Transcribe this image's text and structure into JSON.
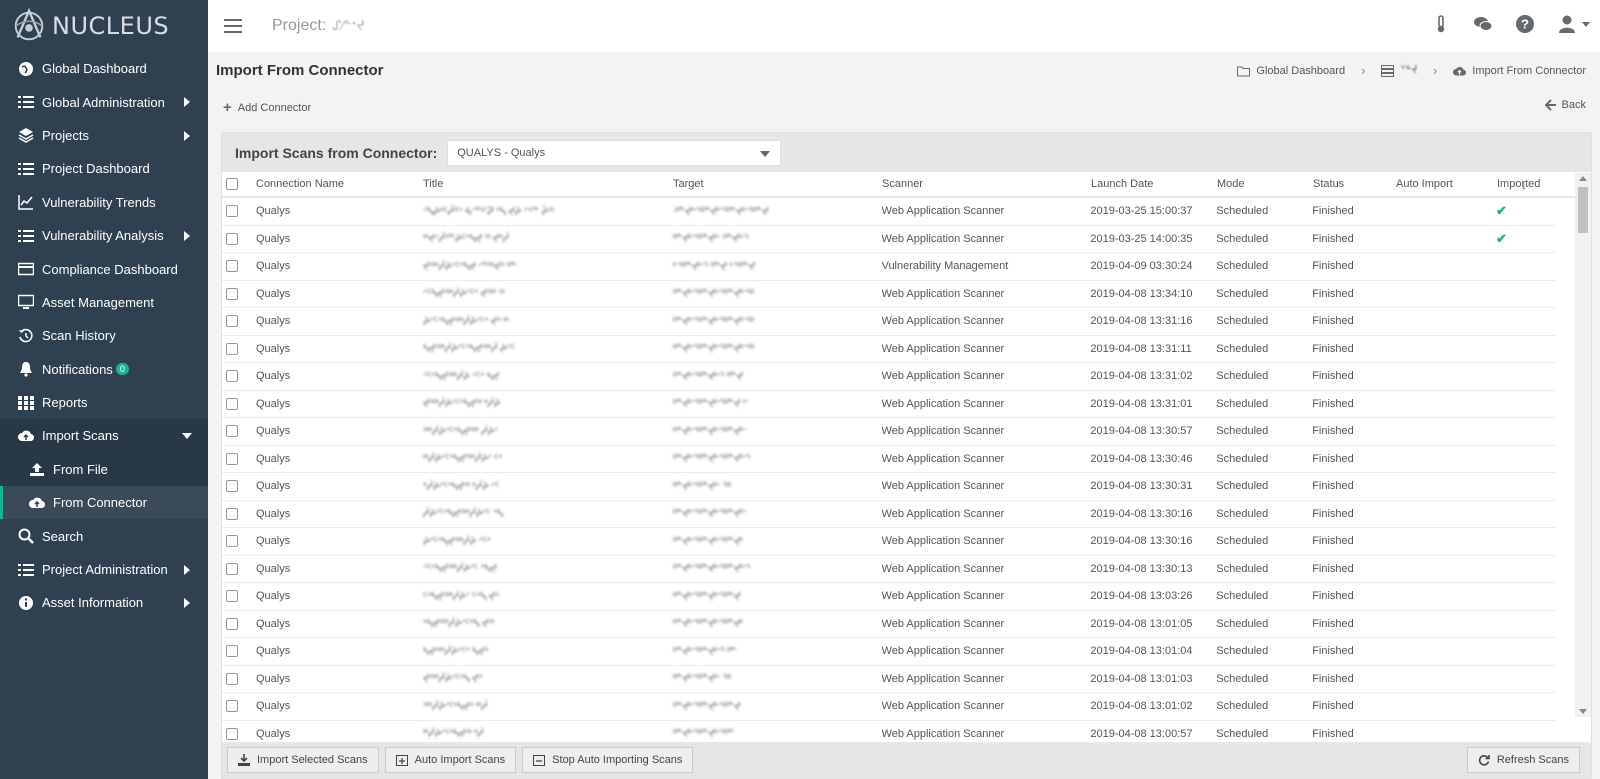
{
  "app": {
    "logo_text": "NUCLEUS"
  },
  "sidebar": {
    "items": [
      {
        "label": "Global Dashboard",
        "icon": "globe-icon"
      },
      {
        "label": "Global Administration",
        "icon": "list-icon"
      },
      {
        "label": "Projects",
        "icon": "layers-icon"
      },
      {
        "label": "Project Dashboard",
        "icon": "list-icon"
      },
      {
        "label": "Vulnerability Trends",
        "icon": "line-chart-icon"
      },
      {
        "label": "Vulnerability Analysis",
        "icon": "list-icon"
      },
      {
        "label": "Compliance Dashboard",
        "icon": "credit-card-icon"
      },
      {
        "label": "Asset Management",
        "icon": "desktop-icon"
      },
      {
        "label": "Scan History",
        "icon": "history-icon"
      },
      {
        "label": "Notifications",
        "icon": "bell-icon",
        "badge": "0"
      },
      {
        "label": "Reports",
        "icon": "grid-icon"
      },
      {
        "label": "Import Scans",
        "icon": "cloud-upload-icon"
      },
      {
        "label": "From File",
        "icon": "upload-icon"
      },
      {
        "label": "From Connector",
        "icon": "cloud-upload-icon"
      },
      {
        "label": "Search",
        "icon": "search-icon"
      },
      {
        "label": "Project Administration",
        "icon": "list-icon"
      },
      {
        "label": "Asset Information",
        "icon": "info-icon"
      }
    ]
  },
  "topbar": {
    "project_label": "Project:",
    "project_name": "ᔑ⁄ᓐᐩᔪ"
  },
  "page": {
    "title": "Import From Connector",
    "breadcrumb": [
      {
        "label": "Global Dashboard",
        "icon": "folder-icon"
      },
      {
        "label": "ᘁᓐᔪ",
        "icon": "server-icon"
      },
      {
        "label": "Import From Connector",
        "icon": "cloud-upload-icon"
      }
    ],
    "add_connector": "Add Connector",
    "back": "Back"
  },
  "panel": {
    "heading": "Import Scans from Connector:",
    "selected_connector": "QUALYS - Qualys",
    "columns": [
      "Connection Name",
      "Title",
      "Target",
      "Scanner",
      "Launch Date",
      "Mode",
      "Status",
      "Auto Import",
      "Imported"
    ],
    "rows": [
      {
        "name": "Qualys",
        "title": "ᐟᓴᔨᐤᑦᓲᕁᐩ ᔦᐨᓐᑊᐟᕈ ᐣᓴ ᔪᔨ ᐟᑉᓐ ᔩᐣᑊ",
        "target": "ᐧᐦᓐᔪᑊᐨᕐᐦᓐᔪᑊᐨᕐᐦᓐᔪᑊᐨᕐᐦᓐᔪ",
        "scanner": "Web Application Scanner",
        "date": "2019-03-25 15:00:37",
        "mode": "Scheduled",
        "status": "Finished",
        "imported": "✔"
      },
      {
        "name": "Qualys",
        "title": "ᑊᐤᔪᐟᓲᐣᓐᔨᑦᐩᓴᔪ ᐣᑊ ᔪᐤᓲ",
        "target": "ᐦᓐᔪᑊᐨᕐᐦᓐᔪᑊᐨ ᐦᓐᔪᑊᐨᕐ",
        "scanner": "Web Application Scanner",
        "date": "2019-03-25 14:00:35",
        "mode": "Scheduled",
        "status": "Finished",
        "imported": "✔"
      },
      {
        "name": "Qualys",
        "title": "ᔪᐣᑊᐤᓲᔨᐟᑦᐩᓴᔪ ᐟᓐᑊᐤᔪᐣ ᐦᓐ",
        "target": "ᑊᐨᕐᐦᓐᔪᑊᐨᕐ ᐦᓐᔪ ᑊᐨᕐᐦᓐᔪ",
        "scanner": "Vulnerability Management",
        "date": "2019-04-09 03:30:24",
        "mode": "Scheduled",
        "status": "Finished",
        "imported": ""
      },
      {
        "name": "Qualys",
        "title": "ᐟᑦᓴᔪᐣᑊᐤᓲᔨᐟᑦᐩ ᔪᐣᑊᐤ ᐣᑊ",
        "target": "ᐦᓐᔪᑊᐨᕐᐦᓐᔪᑊᐨᕐᐦᓐᔪᑊᐨᕐᐦ",
        "scanner": "Web Application Scanner",
        "date": "2019-04-08 13:34:10",
        "mode": "Scheduled",
        "status": "Finished",
        "imported": ""
      },
      {
        "name": "Qualys",
        "title": "ᔨᐟᑦᐩᓴᔪᐣᑊᐤᓲᔨᐟᑦᐩ ᔪᐣ ᑊᐤ",
        "target": "ᐦᓐᔪᑊᐨᕐᐦᓐᔪᑊᐨᕐᐦᓐᔪᑊᐨᕐᐦ",
        "scanner": "Web Application Scanner",
        "date": "2019-04-08 13:31:16",
        "mode": "Scheduled",
        "status": "Finished",
        "imported": ""
      },
      {
        "name": "Qualys",
        "title": "ᓴᔪᐣᑊᐤᓲᔨᐟᑦᐩᓴᔪᐣᑊᐤᓲ ᔨᐟᑦ",
        "target": "ᐦᓐᔪᑊᐨᕐᐦᓐᔪᑊᐨᕐᐦᓐᔪᑊᐨᕐᐦ",
        "scanner": "Web Application Scanner",
        "date": "2019-04-08 13:31:11",
        "mode": "Scheduled",
        "status": "Finished",
        "imported": ""
      },
      {
        "name": "Qualys",
        "title": "ᐟᑦᐩᓴᔪᐣᑊᐤᓲᔨ ᐟᑦᐩ ᓴᔪ",
        "target": "ᐦᓐᔪᑊᐨᕐᐦᓐᔪᑊᐨᕐ ᐦᓐᔪ",
        "scanner": "Web Application Scanner",
        "date": "2019-04-08 13:31:02",
        "mode": "Scheduled",
        "status": "Finished",
        "imported": ""
      },
      {
        "name": "Qualys",
        "title": "ᔪᐣᑊᐤᓲᔨᐟᑦᐩᓴᔪᐣᑊ ᐤᓲᔨ",
        "target": "ᐦᓐᔪᑊᐨᕐᐦᓐᔪᑊᐨᕐᐦᓐᔪ ᑊᐨ",
        "scanner": "Web Application Scanner",
        "date": "2019-04-08 13:31:01",
        "mode": "Scheduled",
        "status": "Finished",
        "imported": ""
      },
      {
        "name": "Qualys",
        "title": "ᐣᑊᐤᓲᔨᐟᑦᐩᓴᔪᐣᑊᐤ ᓲᔨᐟ",
        "target": "ᐦᓐᔪᑊᐨᕐᐦᓐᔪᑊᐨᕐᐦᓐᔪᑊᐨ",
        "scanner": "Web Application Scanner",
        "date": "2019-04-08 13:30:57",
        "mode": "Scheduled",
        "status": "Finished",
        "imported": ""
      },
      {
        "name": "Qualys",
        "title": "ᑊᐤᓲᔨᐟᑦᐩᓴᔪᐣᑊᐤᓲᔨᐟ ᑦᐩ",
        "target": "ᐦᓐᔪᑊᐨᕐᐦᓐᔪᑊᐨᕐᐦᓐᔪᑊᐨᕐ",
        "scanner": "Web Application Scanner",
        "date": "2019-04-08 13:30:46",
        "mode": "Scheduled",
        "status": "Finished",
        "imported": ""
      },
      {
        "name": "Qualys",
        "title": "ᐤᓲᔨᐟᑦᐩᓴᔪᐣᑊ ᐤᓲᔨ ᐟᑦ",
        "target": "ᐦᓐᔪᑊᐨᕐᐦᓐᔪᑊᐨ ᕐᐦ",
        "scanner": "Web Application Scanner",
        "date": "2019-04-08 13:30:31",
        "mode": "Scheduled",
        "status": "Finished",
        "imported": ""
      },
      {
        "name": "Qualys",
        "title": "ᓲᔨᐟᑦᐩᓴᔪᐣᑊᐤᓲᔨᐟᑦ ᐩᓴ",
        "target": "ᐦᓐᔪᑊᐨᕐᐦᓐᔪᑊᐨᕐᐦᓐᔪᑊᐨ",
        "scanner": "Web Application Scanner",
        "date": "2019-04-08 13:30:16",
        "mode": "Scheduled",
        "status": "Finished",
        "imported": ""
      },
      {
        "name": "Qualys",
        "title": "ᔨᐟᑦᐩᓴᔪᐣᑊᐤᓲᔨ ᐟᑦᐩ",
        "target": "ᐦᓐᔪᑊᐨᕐᐦᓐᔪᑊᐨᕐᐦᓐᔪᑊ",
        "scanner": "Web Application Scanner",
        "date": "2019-04-08 13:30:16",
        "mode": "Scheduled",
        "status": "Finished",
        "imported": ""
      },
      {
        "name": "Qualys",
        "title": "ᐟᑦᐩᓴᔪᐣᑊᐤᓲᔨᐟᑦ ᐩᓴᔪ",
        "target": "ᐦᓐᔪᑊᐨᕐᐦᓐᔪᑊᐨᕐᐦᓐᔪᑊᐨᕐ",
        "scanner": "Web Application Scanner",
        "date": "2019-04-08 13:30:13",
        "mode": "Scheduled",
        "status": "Finished",
        "imported": ""
      },
      {
        "name": "Qualys",
        "title": "ᑦᐩᓴᔪᐣᑊᐤᓲᔨᐟ ᑦᐩᓴ ᔪᐣ",
        "target": "ᐦᓐᔪᑊᐨᕐᐦᓐᔪᑊᐨᕐᐦᓐᔪ",
        "scanner": "Web Application Scanner",
        "date": "2019-04-08 13:03:26",
        "mode": "Scheduled",
        "status": "Finished",
        "imported": ""
      },
      {
        "name": "Qualys",
        "title": "ᐩᓴᔪᐣᑊᐤᓲᔨᐟᑦᐩᓴ ᔪᐣᑊ",
        "target": "ᐦᓐᔪᑊᐨᕐᐦᓐᔪᑊᐨᕐᐦᓐᔪᑊ",
        "scanner": "Web Application Scanner",
        "date": "2019-04-08 13:01:05",
        "mode": "Scheduled",
        "status": "Finished",
        "imported": ""
      },
      {
        "name": "Qualys",
        "title": "ᓴᔪᐣᑊᐤᓲᔨᐟᑦᐩ ᓴᔪᐣ",
        "target": "ᐦᓐᔪᑊᐨᕐᐦᓐᔪᑊᐨᕐ ᐦᓐ",
        "scanner": "Web Application Scanner",
        "date": "2019-04-08 13:01:04",
        "mode": "Scheduled",
        "status": "Finished",
        "imported": ""
      },
      {
        "name": "Qualys",
        "title": "ᔪᐣᑊᐤᓲᔨᐟᑦᐩᓴ ᔪᐣ",
        "target": "ᐦᓐᔪᑊᐨᕐᐦᓐᔪᑊᐨ ᕐᐦ",
        "scanner": "Web Application Scanner",
        "date": "2019-04-08 13:01:03",
        "mode": "Scheduled",
        "status": "Finished",
        "imported": ""
      },
      {
        "name": "Qualys",
        "title": "ᐣᑊᐤᓲᔨᐟᑦᐩᓴᔪᐣ ᑊᐤᓲ",
        "target": "ᐦᓐᔪᑊᐨᕐᐦᓐᔪᑊᐨᕐᐦᓐᔪ",
        "scanner": "Web Application Scanner",
        "date": "2019-04-08 13:01:02",
        "mode": "Scheduled",
        "status": "Finished",
        "imported": ""
      },
      {
        "name": "Qualys",
        "title": "ᑊᐤᓲᔨᐟᑦᐩᓴᔪᐣᑊ ᐤᓲ",
        "target": "ᐦᓐᔪᑊᐨᕐᐦᓐᔪᑊᐨᕐᐦᓐ",
        "scanner": "Web Application Scanner",
        "date": "2019-04-08 13:00:57",
        "mode": "Scheduled",
        "status": "Finished",
        "imported": ""
      }
    ]
  },
  "footer": {
    "import_selected": "Import Selected Scans",
    "auto_import": "Auto Import Scans",
    "stop_auto": "Stop Auto Importing Scans",
    "refresh": "Refresh Scans"
  },
  "colors": {
    "sidebar": "#2f4050",
    "accent": "#1ab394"
  }
}
